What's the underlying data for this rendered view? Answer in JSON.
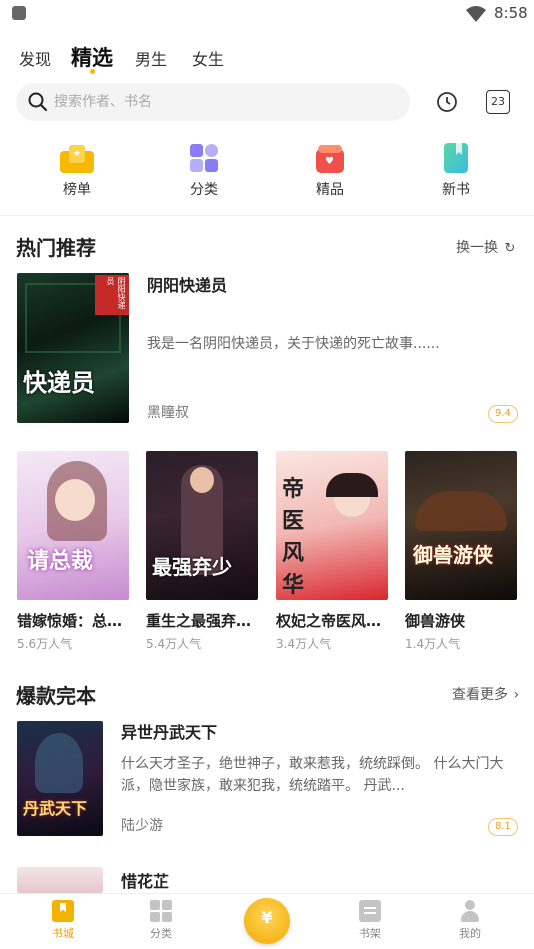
{
  "status": {
    "time": "8:58"
  },
  "top_tabs": [
    "发现",
    "精选",
    "男生",
    "女生"
  ],
  "search": {
    "placeholder": "搜索作者、书名"
  },
  "calendar_day": "23",
  "categories": [
    {
      "label": "榜单",
      "icon": "ranking-icon",
      "color": "#f6b800"
    },
    {
      "label": "分类",
      "icon": "category-icon",
      "color": "#8a7cf2"
    },
    {
      "label": "精品",
      "icon": "premium-gift-icon",
      "color": "#f0504a"
    },
    {
      "label": "新书",
      "icon": "new-book-icon",
      "color": "#3dc9b8"
    }
  ],
  "hot": {
    "title": "热门推荐",
    "refresh_label": "换一换",
    "featured": {
      "title": "阴阳快递员",
      "desc": "我是一名阴阳快递员，关于快递的死亡故事......",
      "author": "黑瞳叔",
      "score": "9.4",
      "cover_text": "快递员",
      "cover_badge": "阴阳快递员"
    },
    "grid": [
      {
        "title": "错嫁惊婚：总…",
        "pop": "5.6万人气",
        "cover_text": "请总裁"
      },
      {
        "title": "重生之最强弃…",
        "pop": "5.4万人气",
        "cover_text": "最强弃少"
      },
      {
        "title": "权妃之帝医风…",
        "pop": "3.4万人气",
        "cover_text": "帝医风华"
      },
      {
        "title": "御兽游侠",
        "pop": "1.4万人气",
        "cover_text": "御兽游侠"
      }
    ]
  },
  "complete": {
    "title": "爆款完本",
    "more_label": "查看更多",
    "books": [
      {
        "title": "异世丹武天下",
        "desc": "什么天才圣子，绝世神子，敢来惹我，统统踩倒。 什么大门大派，隐世家族，敢来犯我，统统踏平。 丹武...",
        "author": "陆少游",
        "score": "8.1",
        "cover_text": "丹武天下"
      },
      {
        "title": "惜花芷"
      }
    ]
  },
  "bottom_tabs": [
    {
      "label": "书城",
      "active": true
    },
    {
      "label": "分类",
      "active": false
    },
    {
      "label": "书架",
      "active": false
    },
    {
      "label": "我的",
      "active": false
    }
  ],
  "center_symbol": "¥"
}
